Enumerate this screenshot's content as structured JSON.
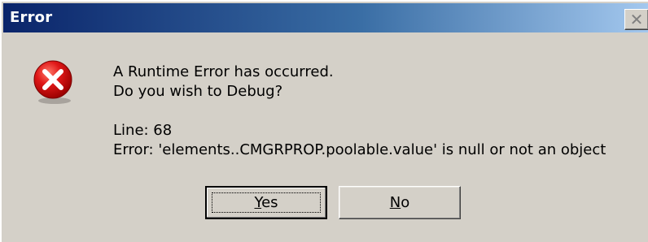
{
  "window": {
    "title": "Error",
    "close_glyph": "✕"
  },
  "icon": {
    "name": "error-icon",
    "color": "#e01818"
  },
  "message": {
    "line1": "A Runtime Error has occurred.",
    "line2": "Do you wish to Debug?",
    "line3": "Line: 68",
    "line4": "Error: 'elements..CMGRPROP.poolable.value' is null or not an object"
  },
  "buttons": {
    "yes": {
      "label": "Yes",
      "mnemonic": "Y",
      "rest": "es"
    },
    "no": {
      "label": "No",
      "mnemonic": "N",
      "rest": "o"
    }
  }
}
